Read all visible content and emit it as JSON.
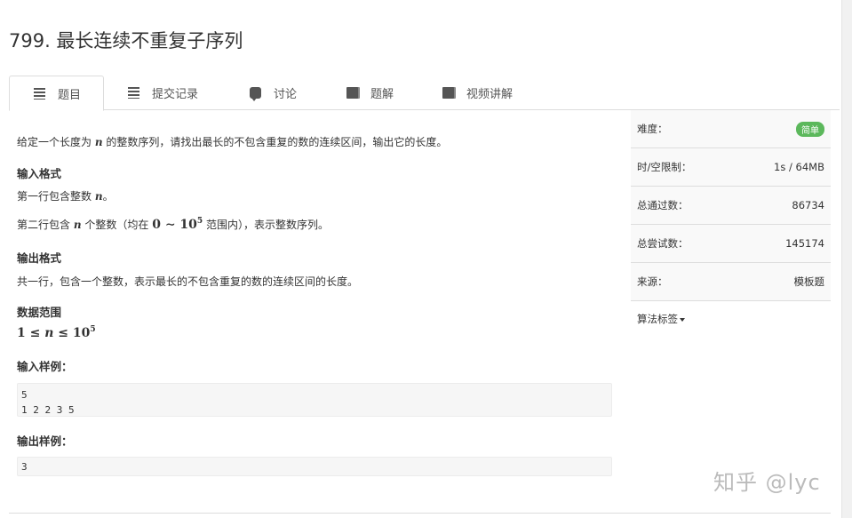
{
  "problem": {
    "title": "799. 最长连续不重复子序列"
  },
  "tabs": [
    {
      "label": "题目"
    },
    {
      "label": "提交记录"
    },
    {
      "label": "讨论"
    },
    {
      "label": "题解"
    },
    {
      "label": "视频讲解"
    }
  ],
  "content": {
    "description_pre": "给定一个长度为 ",
    "description_var": "n",
    "description_post": " 的整数序列，请找出最长的不包含重复的数的连续区间，输出它的长度。",
    "input_format_heading": "输入格式",
    "input_line1_pre": "第一行包含整数 ",
    "input_line1_var": "n",
    "input_line1_post": "。",
    "input_line2_pre": "第二行包含 ",
    "input_line2_var": "n",
    "input_line2_mid": " 个整数（均在 ",
    "input_line2_math": "0 ∼ 10",
    "input_line2_exp": "5",
    "input_line2_post": " 范围内），表示整数序列。",
    "output_format_heading": "输出格式",
    "output_text": "共一行，包含一个整数，表示最长的不包含重复的数的连续区间的长度。",
    "range_heading": "数据范围",
    "range_math_a": "1 ≤ ",
    "range_math_var": "n",
    "range_math_b": " ≤ 10",
    "range_math_exp": "5",
    "sample_input_heading": "输入样例：",
    "sample_input": "5\n1 2 2 3 5",
    "sample_output_heading": "输出样例：",
    "sample_output": "3"
  },
  "sidebar": {
    "difficulty_label": "难度：",
    "difficulty_value": "简单",
    "limit_label": "时/空限制：",
    "limit_value": "1s / 64MB",
    "passed_label": "总通过数：",
    "passed_value": "86734",
    "attempts_label": "总尝试数：",
    "attempts_value": "145174",
    "source_label": "来源：",
    "source_value": "模板题",
    "tags_label": "算法标签"
  },
  "watermark": "知乎 @lyc",
  "colors": {
    "badge": "#5cb85c",
    "border": "#dddddd",
    "code_bg": "#f6f6f6"
  }
}
